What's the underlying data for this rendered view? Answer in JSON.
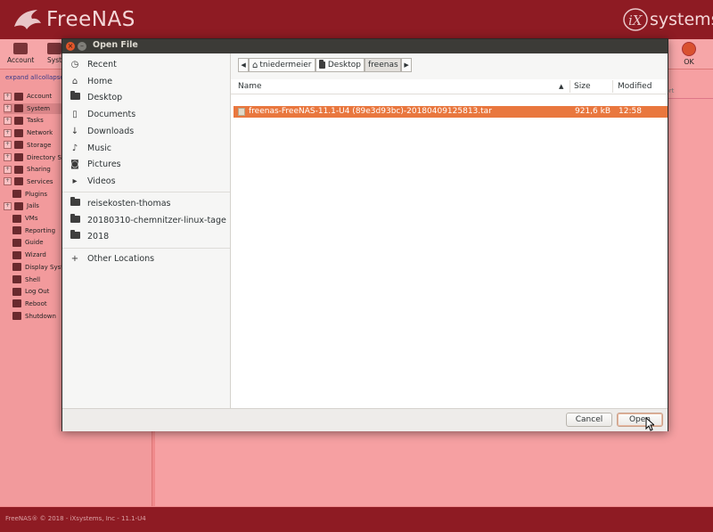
{
  "background": {
    "brand": "FreeNAS",
    "vendor": "iXsystems",
    "toolbar": [
      {
        "label": "Account",
        "icon": "account-icon"
      },
      {
        "label": "Syst",
        "icon": "system-icon"
      }
    ],
    "ok_label": "OK",
    "port_partial": "port",
    "expand_all": "expand all",
    "collapse": "collapse",
    "nav": [
      {
        "label": "Account",
        "expander": "+",
        "icon": "account-icon"
      },
      {
        "label": "System",
        "expander": "+",
        "icon": "system-icon",
        "selected": true
      },
      {
        "label": "Tasks",
        "expander": "+",
        "icon": "tasks-icon"
      },
      {
        "label": "Network",
        "expander": "+",
        "icon": "network-icon"
      },
      {
        "label": "Storage",
        "expander": "+",
        "icon": "storage-icon"
      },
      {
        "label": "Directory Serv",
        "expander": "+",
        "icon": "directory-icon"
      },
      {
        "label": "Sharing",
        "expander": "+",
        "icon": "sharing-icon"
      },
      {
        "label": "Services",
        "expander": "+",
        "icon": "services-icon"
      },
      {
        "label": "Plugins",
        "expander": "",
        "icon": "plugins-icon"
      },
      {
        "label": "Jails",
        "expander": "+",
        "icon": "jails-icon"
      },
      {
        "label": "VMs",
        "expander": "",
        "icon": "vms-icon"
      },
      {
        "label": "Reporting",
        "expander": "",
        "icon": "reporting-icon"
      },
      {
        "label": "Guide",
        "expander": "",
        "icon": "guide-icon"
      },
      {
        "label": "Wizard",
        "expander": "",
        "icon": "wizard-icon"
      },
      {
        "label": "Display Syste",
        "expander": "",
        "icon": "display-icon"
      },
      {
        "label": "Shell",
        "expander": "",
        "icon": "shell-icon"
      },
      {
        "label": "Log Out",
        "expander": "",
        "icon": "logout-icon"
      },
      {
        "label": "Reboot",
        "expander": "",
        "icon": "reboot-icon"
      },
      {
        "label": "Shutdown",
        "expander": "",
        "icon": "shutdown-icon"
      }
    ],
    "footer": "FreeNAS® © 2018 - iXsystems, Inc - 11.1-U4"
  },
  "dialog": {
    "title": "Open File",
    "places": [
      {
        "label": "Recent",
        "icon": "clock-icon",
        "glyph": "◷"
      },
      {
        "label": "Home",
        "icon": "home-icon",
        "glyph": "⌂"
      },
      {
        "label": "Desktop",
        "icon": "folder-icon",
        "glyph": ""
      },
      {
        "label": "Documents",
        "icon": "document-icon",
        "glyph": "▯"
      },
      {
        "label": "Downloads",
        "icon": "download-icon",
        "glyph": "↓"
      },
      {
        "label": "Music",
        "icon": "music-icon",
        "glyph": "♪"
      },
      {
        "label": "Pictures",
        "icon": "camera-icon",
        "glyph": "◙"
      },
      {
        "label": "Videos",
        "icon": "video-icon",
        "glyph": "▸"
      }
    ],
    "bookmarks": [
      {
        "label": "reisekosten-thomas"
      },
      {
        "label": "20180310-chemnitzer-linux-tage"
      },
      {
        "label": "2018"
      }
    ],
    "other_locations": "Other Locations",
    "breadcrumbs": [
      "tniedermeier",
      "Desktop",
      "freenas"
    ],
    "columns": {
      "name": "Name",
      "size": "Size",
      "modified": "Modified"
    },
    "files": [
      {
        "name": "freenas-FreeNAS-11.1-U4 (89e3d93bc)-20180409125813.tar",
        "size": "921,6 kB",
        "modified": "12:58",
        "selected": true
      }
    ],
    "cancel_label": "Cancel",
    "open_label": "Open"
  },
  "colors": {
    "freenas_header": "#8e1b23",
    "selection": "#e9773e",
    "titlebar": "#3c3b37"
  }
}
